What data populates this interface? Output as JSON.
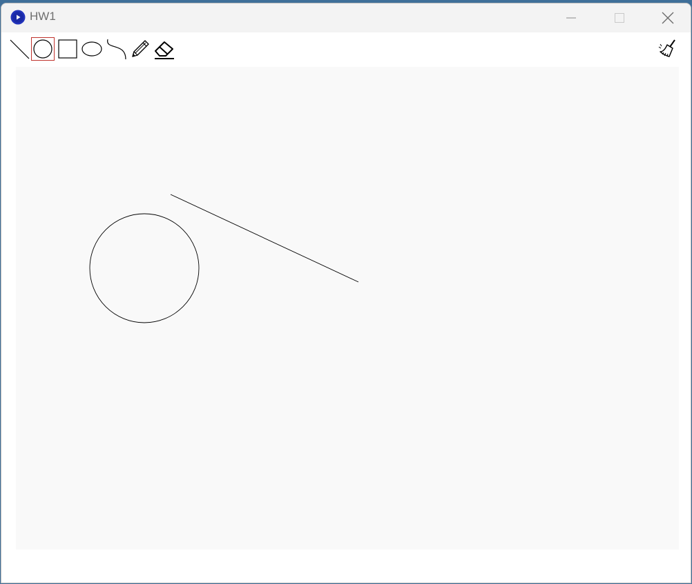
{
  "window": {
    "title": "HW1"
  },
  "toolbar": {
    "tools": [
      {
        "name": "line-tool",
        "icon": "line-icon",
        "selected": false
      },
      {
        "name": "circle-tool",
        "icon": "circle-icon",
        "selected": true
      },
      {
        "name": "rectangle-tool",
        "icon": "rectangle-icon",
        "selected": false
      },
      {
        "name": "ellipse-tool",
        "icon": "ellipse-icon",
        "selected": false
      },
      {
        "name": "curve-tool",
        "icon": "curve-icon",
        "selected": false
      },
      {
        "name": "pencil-tool",
        "icon": "pencil-icon",
        "selected": false
      },
      {
        "name": "eraser-tool",
        "icon": "eraser-icon",
        "selected": false
      }
    ],
    "clear_tool": {
      "icon": "broom-icon"
    }
  },
  "colors": {
    "selected_border": "#c0312b",
    "canvas_background": "#f9f9f9",
    "stroke": "#000000",
    "app_icon": "#2233bb"
  }
}
